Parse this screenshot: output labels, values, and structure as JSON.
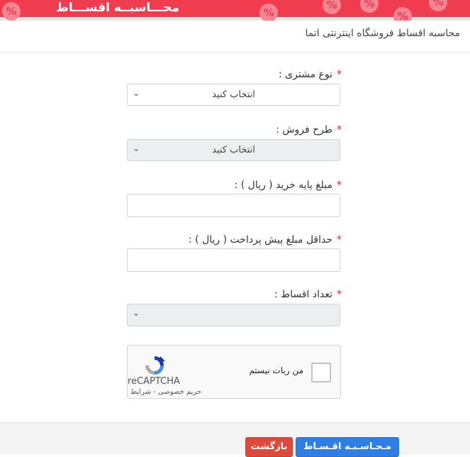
{
  "banner": {
    "title": "محـــاسبــه اقســـاط",
    "badge_glyph": "%"
  },
  "header": {
    "title": "محاسبه اقساط فروشگاه اینترنتی اتما"
  },
  "form": {
    "required_mark": "*",
    "customer_type": {
      "label": "نوع مشتری :",
      "value": "انتخاب کنید"
    },
    "sales_plan": {
      "label": "طرح فروش :",
      "value": "انتخاب کنید"
    },
    "base_amount": {
      "label": "مبلغ پایه خرید ( ریال ) :",
      "value": ""
    },
    "min_prepayment": {
      "label": "حداقل مبلغ پیش پرداخت ( ریال ) :",
      "value": ""
    },
    "installments": {
      "label": "تعداد اقساط :",
      "value": ""
    }
  },
  "captcha": {
    "checkbox_label": "من ربات نیستم",
    "brand": "reCAPTCHA",
    "links": "حریم خصوصی - شرایط"
  },
  "buttons": {
    "calculate": "مـحـاسـبـه اقـسـاط",
    "back": "بازگشت"
  },
  "colors": {
    "banner": "#ef3d4f",
    "primary": "#2f7ee6",
    "danger": "#dd4a3d"
  }
}
